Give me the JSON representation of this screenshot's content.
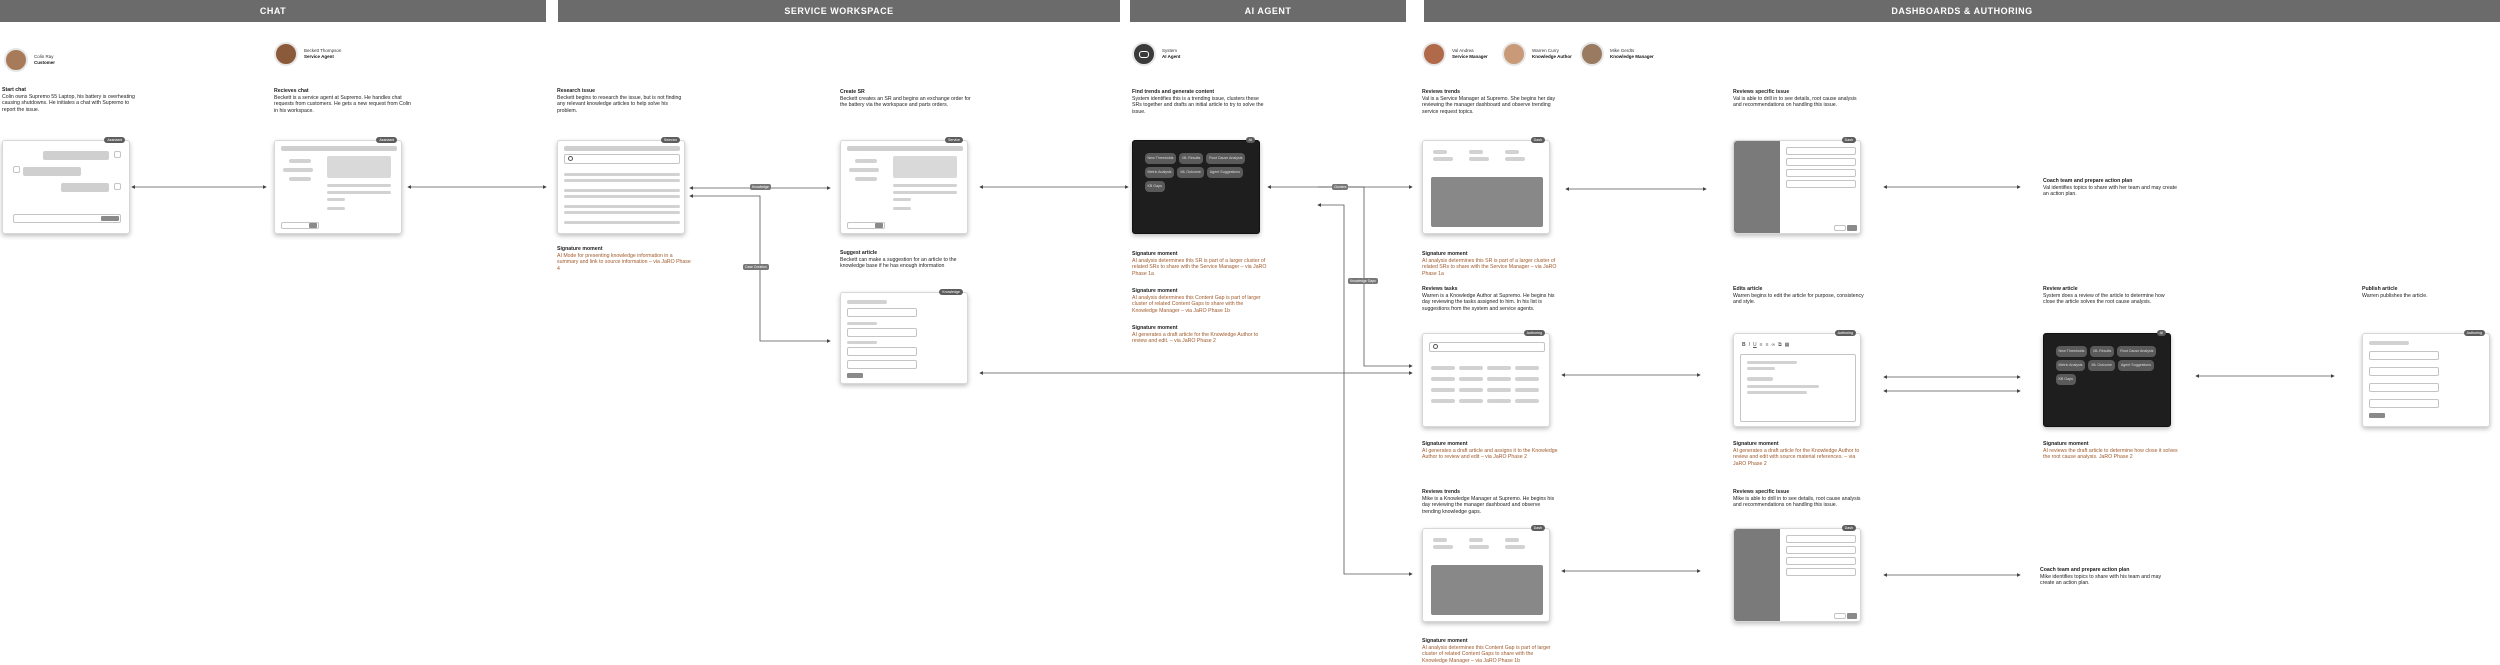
{
  "lanes": {
    "chat": "CHAT",
    "service": "SERVICE WORKSPACE",
    "ai": "AI AGENT",
    "dash": "DASHBOARDS & AUTHORING"
  },
  "personas": {
    "customer": {
      "name": "Colin Ray",
      "role": "Customer"
    },
    "service_agent": {
      "name": "Beckett Thompson",
      "role": "Service Agent"
    },
    "ai_agent": {
      "name": "System",
      "role": "AI Agent"
    },
    "service_manager": {
      "name": "Val Andrea",
      "role": "Service Manager"
    },
    "knowledge_author": {
      "name": "Warren Curry",
      "role": "Knowledge Author"
    },
    "knowledge_manager": {
      "name": "Mike Gerdts",
      "role": "Knowledge Manager"
    }
  },
  "steps": {
    "start_chat": {
      "title": "Start chat",
      "body": "Colin owns Supremo 55 Laptop, his battery is overheating causing shutdowns. He initiates a chat with Supremo to report the issue."
    },
    "receives_chat": {
      "title": "Recieves chat",
      "body": "Beckett is a service agent at Supremo. He handles chat requests from customers. He gets a new request from Colin in his workspace."
    },
    "research_issue": {
      "title": "Research issue",
      "body": "Beckett begins to research the issue, but is not finding any relevant knowledge articles to help solve his problem."
    },
    "create_sr": {
      "title": "Create SR",
      "body": "Beckett creates an SR and begins an exchange order for the battery via the workspace and parts orders."
    },
    "suggest_article": {
      "title": "Suggest article",
      "body": "Beckett can make a suggestion for an article to the knowledge base if he has enough information"
    },
    "find_trends": {
      "title": "Find trends and generate content",
      "body": "System identifies this is a trending issue, clusters these SRs together and drafts an initial article to try to solve the issue."
    },
    "reviews_trends_val": {
      "title": "Reviews trends",
      "body": "Val is a Service Manager at Supremo. She begins her day reviewing the manager dashboard and observe trending service request topics."
    },
    "reviews_specific_val": {
      "title": "Reviews specific issue",
      "body": "Val is able to drill in to see details, root cause analysis and recommendations on handling this issue."
    },
    "coach_val": {
      "title": "Coach team and prepare action plan",
      "body": "Val identifies topics to share with her team and may create an action plan."
    },
    "reviews_tasks": {
      "title": "Reviews tasks",
      "body": "Warren is a Knowledge Author at Supremo. He begins his day reviewing the tasks assigned to him. In his list is suggestions from the system and service agents."
    },
    "edits_article": {
      "title": "Edits article",
      "body": "Warren begins to edit the article for purpose, consistency and style."
    },
    "review_article": {
      "title": "Review article",
      "body": "System does a review of the article to determine how close the article solves the root cause analysis."
    },
    "publish_article": {
      "title": "Publish article",
      "body": "Warren publishes the article."
    },
    "reviews_trends_mike": {
      "title": "Reviews trends",
      "body": "Mike is a Knowledge Manager at Supremo. He begins his day reviewing the manager dashboard and observe trending knowledge gaps."
    },
    "reviews_specific_mike": {
      "title": "Reviews specific issue",
      "body": "Mike is able to drill in to see details, root cause analysis and recommendations on handling this issue."
    },
    "coach_mike": {
      "title": "Coach team and prepare action plan",
      "body": "Mike identifies topics to share with his team and may create an action plan."
    }
  },
  "signatures": {
    "s1": {
      "title": "Signature moment",
      "body": "AI Mode for presenting knowledge information in a summary and link to source information – via JaRO Phase 4"
    },
    "s2": {
      "title": "Signature moment",
      "body": "AI analysis determines this SR is part of a larger cluster of related SRs to share with the Service Manager – via JaRO Phase 1a"
    },
    "s3": {
      "title": "Signature moment",
      "body": "AI analysis determines this Content Gap is part of larger cluster of related Content Gaps to share with the Knowledge Manager – via JaRO Phase 1b"
    },
    "s4": {
      "title": "Signature moment",
      "body": "AI generates a draft article for the Knowledge Author to review and edit. – via JaRO Phase 2"
    },
    "s5": {
      "title": "Signature moment",
      "body": "AI analysis determines this SR is part of a larger cluster of related SRs to share with the Service Manager – via JaRO Phase 1a"
    },
    "s6": {
      "title": "Signature moment",
      "body": "AI generates a draft article and assigns it to the Knowledge Author to review and edit – via JaRO Phase 2"
    },
    "s7": {
      "title": "Signature moment",
      "body": "AI generates a draft article for the Knowledge Author to review and edit with source material references. – via JaRO Phase 2"
    },
    "s8": {
      "title": "Signature moment",
      "body": "AI reviews the draft article to determine how close it solves the root cause analysis. JaRO Phase 2"
    },
    "s9": {
      "title": "Signature moment",
      "body": "AI analysis determines this Content Gap is part of larger cluster of related Content Gaps to share with the Knowledge Manager – via JaRO Phase 1b"
    }
  },
  "tags": {
    "chat": "Assistant",
    "receive": "Assistant",
    "research": "Selector",
    "create_sr": "Service",
    "suggest": "Knowledge",
    "ai": "AI",
    "dash1": "Dash",
    "spec1": "Dash",
    "tasks": "Authoring",
    "edit": "Authoring",
    "review": "AI",
    "publish": "Authoring",
    "dash2": "Dash",
    "spec2": "Dash"
  },
  "pills": [
    "New Thresholds",
    "ML Results",
    "Root Cause Analysis",
    "Metric Analysis",
    "ML Outcome",
    "Agent Suggestions",
    "KB Gaps"
  ],
  "flow_labels": {
    "f1": "Knowledge",
    "f2": "Case Creation",
    "f3": "Clusters",
    "f4": "Knowledge Gaps"
  },
  "colors": {
    "lane": "#6b6b6b",
    "signature": "#a05a2c",
    "dark_card": "#1e1e1e"
  }
}
